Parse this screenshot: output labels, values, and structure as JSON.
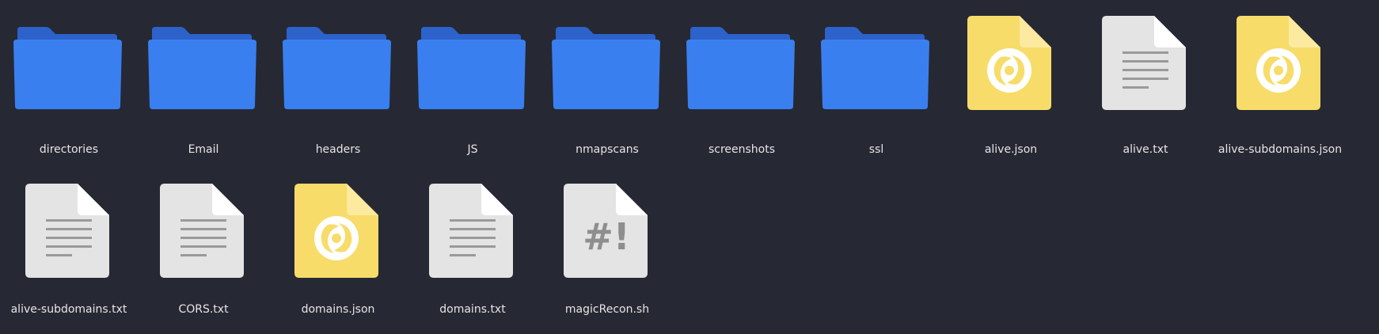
{
  "file_manager": {
    "items": [
      {
        "name": "directories",
        "kind": "folder",
        "icon": "folder-icon"
      },
      {
        "name": "Email",
        "kind": "folder",
        "icon": "folder-icon"
      },
      {
        "name": "headers",
        "kind": "folder",
        "icon": "folder-icon"
      },
      {
        "name": "JS",
        "kind": "folder",
        "icon": "folder-icon"
      },
      {
        "name": "nmapscans",
        "kind": "folder",
        "icon": "folder-icon"
      },
      {
        "name": "screenshots",
        "kind": "folder",
        "icon": "folder-icon"
      },
      {
        "name": "ssl",
        "kind": "folder",
        "icon": "folder-icon"
      },
      {
        "name": "alive.json",
        "kind": "json",
        "icon": "json-file-icon"
      },
      {
        "name": "alive.txt",
        "kind": "text",
        "icon": "text-file-icon"
      },
      {
        "name": "alive-subdomains.json",
        "kind": "json",
        "icon": "json-file-icon"
      },
      {
        "name": "alive-subdomains.txt",
        "kind": "text",
        "icon": "text-file-icon"
      },
      {
        "name": "CORS.txt",
        "kind": "text",
        "icon": "text-file-icon"
      },
      {
        "name": "domains.json",
        "kind": "json",
        "icon": "json-file-icon"
      },
      {
        "name": "domains.txt",
        "kind": "text",
        "icon": "text-file-icon"
      },
      {
        "name": "magicRecon.sh",
        "kind": "script",
        "icon": "shell-script-icon",
        "glyph": "#!"
      }
    ]
  },
  "colors": {
    "background": "#262833",
    "folder_front": "#3a7ff0",
    "folder_back": "#2c62c9",
    "json_page": "#f7dc6a",
    "json_fold": "#fbeaa0",
    "text_page": "#e4e4e4",
    "text_fold": "#ffffff",
    "text_lines": "#9a9a9a",
    "label": "#e6e6e6"
  }
}
